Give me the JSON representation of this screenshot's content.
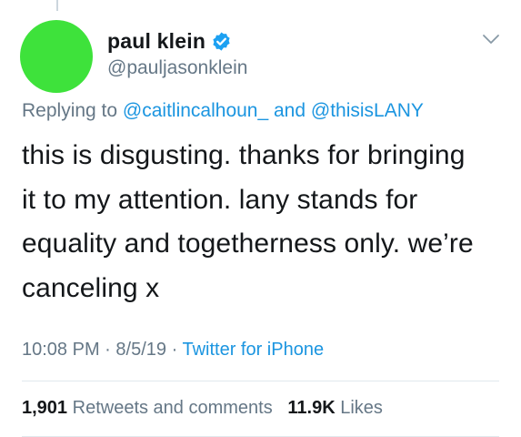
{
  "tweet": {
    "author": {
      "display_name": "paul klein",
      "handle": "@pauljasonklein",
      "avatar_color": "#3ee23b",
      "verified": true
    },
    "replying": {
      "prefix": "Replying to",
      "mention1": "@caitlincalhoun_",
      "and": "and",
      "mention2": "@thisisLANY"
    },
    "text": {
      "line1": "this is disgusting. thanks for bringing",
      "line2": "it to my attention. lany stands for",
      "line3": "equality and togetherness only. we’re",
      "line4": "canceling x"
    },
    "meta": {
      "time": "10:08 PM",
      "sep1": "·",
      "date": "8/5/19",
      "sep2": "·",
      "source": "Twitter for iPhone"
    },
    "stats": {
      "retweets_count": "1,901",
      "retweets_label": "Retweets and comments",
      "likes_count": "11.9K",
      "likes_label": "Likes"
    }
  },
  "colors": {
    "link": "#1b95e0",
    "secondary_text": "#657786",
    "primary_text": "#14171a",
    "divider": "#e1e8ed"
  },
  "icons": {
    "verified": "verified-badge-icon",
    "menu": "chevron-down-icon"
  }
}
